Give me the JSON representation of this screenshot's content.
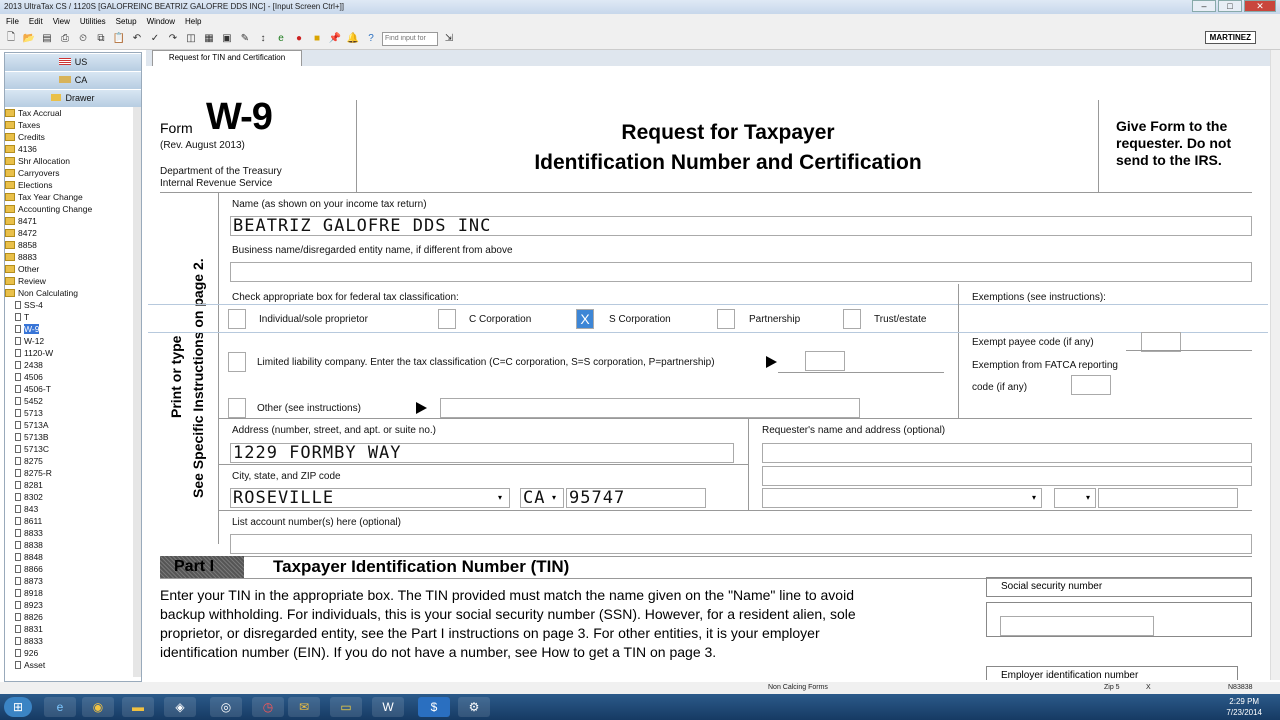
{
  "window": {
    "title": "2013 UltraTax CS / 1120S [GALOFREINC BEATRIZ GALOFRE DDS INC] - [Input Screen   Ctrl+]]"
  },
  "menu": [
    "File",
    "Edit",
    "View",
    "Utilities",
    "Setup",
    "Window",
    "Help"
  ],
  "toolbar": {
    "find_placeholder": "Find input for",
    "user": "MARTINEZ"
  },
  "sidebar": {
    "buttons": [
      "US",
      "CA",
      "Drawer"
    ],
    "folders": [
      "Tax Accrual",
      "Taxes",
      "Credits",
      "4136",
      "Shr Allocation",
      "Carryovers",
      "Elections",
      "Tax Year Change",
      "Accounting Change",
      "8471",
      "8472",
      "8858",
      "8883",
      "Other",
      "Review",
      "Non Calculating"
    ],
    "docs": [
      "SS-4",
      "T",
      "W-9",
      "W-12",
      "1120-W",
      "2438",
      "4506",
      "4506-T",
      "5452",
      "5713",
      "5713A",
      "5713B",
      "5713C",
      "8275",
      "8275-R",
      "8281",
      "8302",
      "843",
      "8611",
      "8833",
      "8838",
      "8848",
      "8866",
      "8873",
      "8918",
      "8923",
      "8826",
      "8831",
      "8833",
      "926",
      "Asset"
    ],
    "selected": "W-9"
  },
  "tab": {
    "label": "Request for TIN and Certification"
  },
  "form": {
    "form_label": "Form",
    "form_number": "W-9",
    "rev": "(Rev. August 2013)",
    "dept1": "Department of the Treasury",
    "dept2": "Internal Revenue Service",
    "title1": "Request for Taxpayer",
    "title2": "Identification Number and Certification",
    "give_form": "Give Form to the requester. Do not send to the IRS.",
    "side_text1": "Print or type",
    "side_text2": "See Specific Instructions on page 2.",
    "name_label": "Name (as shown on your income tax return)",
    "name_value": "BEATRIZ GALOFRE DDS INC",
    "business_label": "Business name/disregarded entity name, if different from above",
    "classification_label": "Check appropriate box for federal tax classification:",
    "exemptions_label": "Exemptions (see instructions):",
    "opt_individual": "Individual/sole proprietor",
    "opt_ccorp": "C Corporation",
    "opt_scorp": "S Corporation",
    "opt_partnership": "Partnership",
    "opt_trust": "Trust/estate",
    "checked_mark": "X",
    "llc_label": "Limited liability company. Enter the tax classification (C=C corporation, S=S corporation, P=partnership)",
    "other_label": "Other (see instructions)",
    "exempt_payee": "Exempt payee code (if any)",
    "fatca_label1": "Exemption from FATCA reporting",
    "fatca_label2": "code (if any)",
    "address_label": "Address (number, street, and apt. or suite no.)",
    "address_value": "1229 FORMBY WAY",
    "requester_label": "Requester's name and address (optional)",
    "city_label": "City, state, and ZIP code",
    "city_value": "ROSEVILLE",
    "state_value": "CA",
    "zip_value": "95747",
    "account_label": "List account number(s) here (optional)",
    "part_label": "Part I",
    "part_title": "Taxpayer Identification Number (TIN)",
    "instructions": "Enter your TIN in the appropriate box. The TIN provided must match the name given on the \"Name\" line to avoid backup withholding. For individuals, this is your social security number (SSN). However, for a resident alien, sole proprietor, or disregarded entity, see the Part I instructions on page 3. For other entities, it is your employer identification number (EIN). If you do not have a number, see How to get a TIN on page 3.",
    "ssn_label": "Social security number",
    "ein_label": "Employer identification number"
  },
  "status": {
    "left": "Non Calcing Forms",
    "mid1": "Zip 5",
    "mid2": "X",
    "right": "N83838"
  },
  "clock": {
    "time": "2:29 PM",
    "date": "7/23/2014"
  }
}
